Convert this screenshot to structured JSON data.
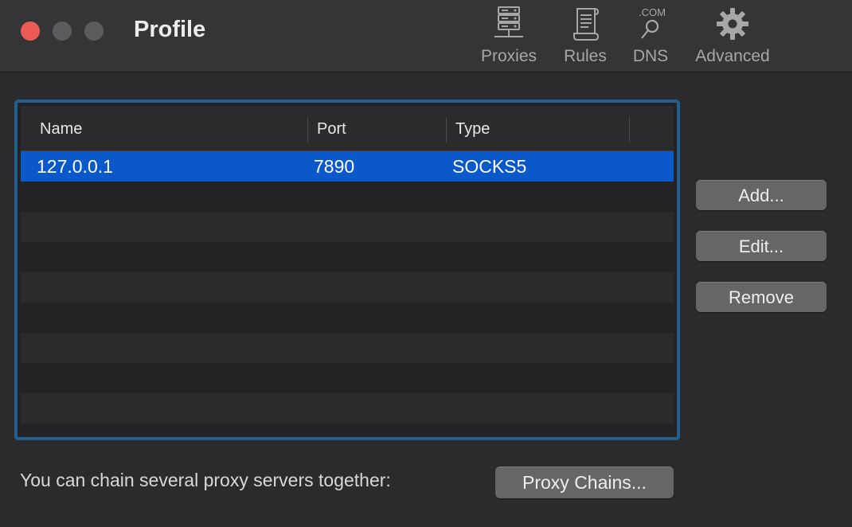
{
  "window": {
    "title": "Profile",
    "controls": [
      "close",
      "minimize",
      "maximize"
    ]
  },
  "toolbar": {
    "items": [
      {
        "label": "Proxies",
        "icon": "server-icon"
      },
      {
        "label": "Rules",
        "icon": "scroll-icon"
      },
      {
        "label": "DNS",
        "icon": "dns-magnifier-icon",
        "icon_text": ".COM"
      },
      {
        "label": "Advanced",
        "icon": "gear-icon"
      }
    ]
  },
  "table": {
    "columns": [
      "Name",
      "Port",
      "Type"
    ],
    "rows": [
      {
        "name": "127.0.0.1",
        "port": "7890",
        "type": "SOCKS5",
        "selected": true
      }
    ]
  },
  "actions": {
    "add": "Add...",
    "edit": "Edit...",
    "remove": "Remove"
  },
  "footer": {
    "text": "You can chain several proxy servers together:",
    "chains_button": "Proxy Chains..."
  },
  "colors": {
    "selection": "#0a58ca",
    "focus_ring": "#235f8e",
    "close_button": "#ed5b56"
  }
}
